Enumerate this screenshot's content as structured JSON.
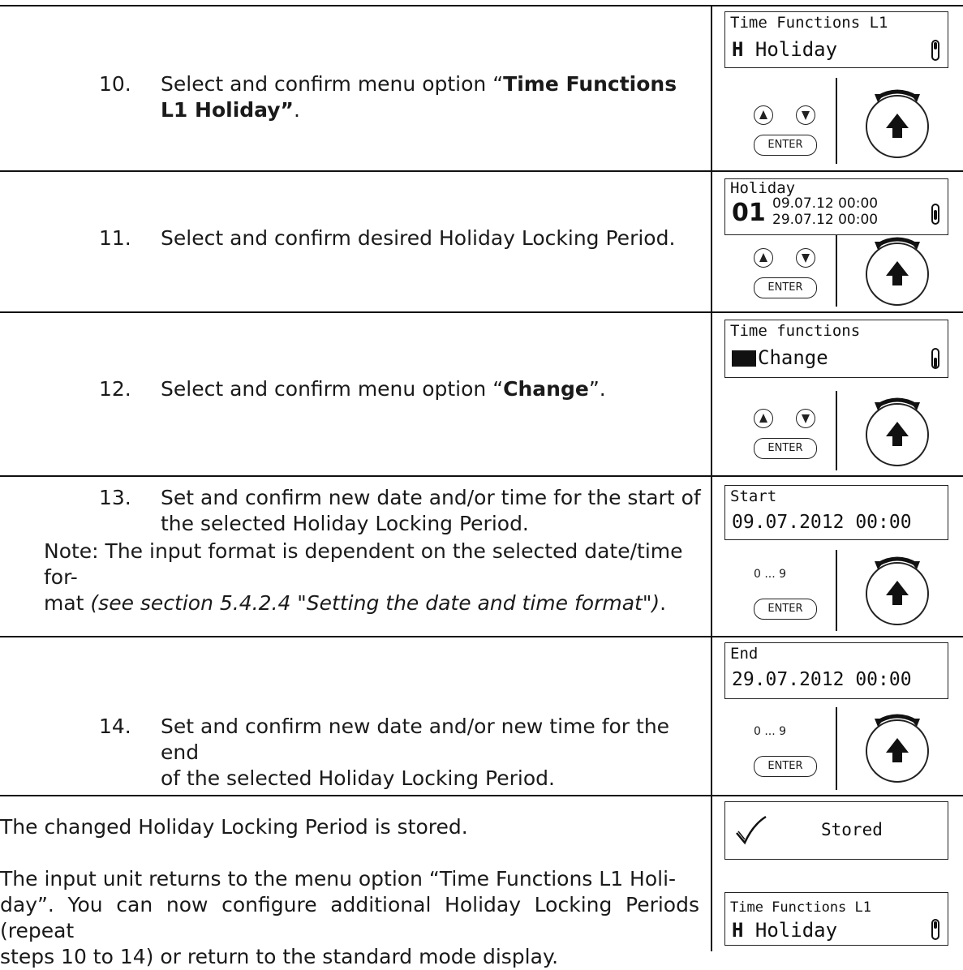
{
  "steps": [
    {
      "num": "10.",
      "pre": "Select and confirm menu option “",
      "bold": "Time Functions L1 Holiday”",
      "post": ".",
      "lcd_title": "Time Functions L1",
      "lcd_icon": "H",
      "lcd_value": "Holiday",
      "keys": "arrows",
      "enter": "ENTER"
    },
    {
      "num": "11.",
      "text": "Select and confirm desired Holiday Locking Period.",
      "lcd_title": "Holiday",
      "lcd_index": "01",
      "lcd_start": "09.07.12 00:00",
      "lcd_end": "29.07.12 00:00",
      "keys": "arrows",
      "enter": "ENTER"
    },
    {
      "num": "12.",
      "pre": "Select and confirm menu option “",
      "bold": "Change",
      "post": "”.",
      "lcd_title": "Time functions",
      "lcd_value": "Change",
      "keys": "arrows",
      "enter": "ENTER"
    },
    {
      "num": "13.",
      "line1": "Set and confirm new date and/or time for the start of",
      "line2": "the selected Holiday Locking Period.",
      "note_pre": "Note: The input format is dependent on the selected date/time for-",
      "note_mid": "mat ",
      "note_italic": "(see section 5.4.2.4 \"Setting the date and time format\")",
      "note_post": ".",
      "lcd_title": "Start",
      "lcd_value": "09.07.2012 00:00",
      "keys": "digits",
      "digits_label": "0 ... 9",
      "enter": "ENTER"
    },
    {
      "num": "14.",
      "line1": "Set and confirm new date and/or new time for the end",
      "line2": "of the selected Holiday Locking Period.",
      "lcd_title": "End",
      "lcd_value": "29.07.2012 00:00",
      "keys": "digits",
      "digits_label": "0 ... 9",
      "enter": "ENTER"
    }
  ],
  "result": {
    "stored_line": "The changed Holiday Locking Period is stored.",
    "stored_lcd": "Stored",
    "return_lines": [
      "The input unit returns to the menu option “Time Functions L1 Holi-",
      "day”. You can now configure additional Holiday Locking Periods (repeat",
      "steps 10 to 14) or return to the standard mode display."
    ],
    "final_lcd_title": "Time Functions L1",
    "final_lcd_icon": "H",
    "final_lcd_value": "Holiday"
  }
}
